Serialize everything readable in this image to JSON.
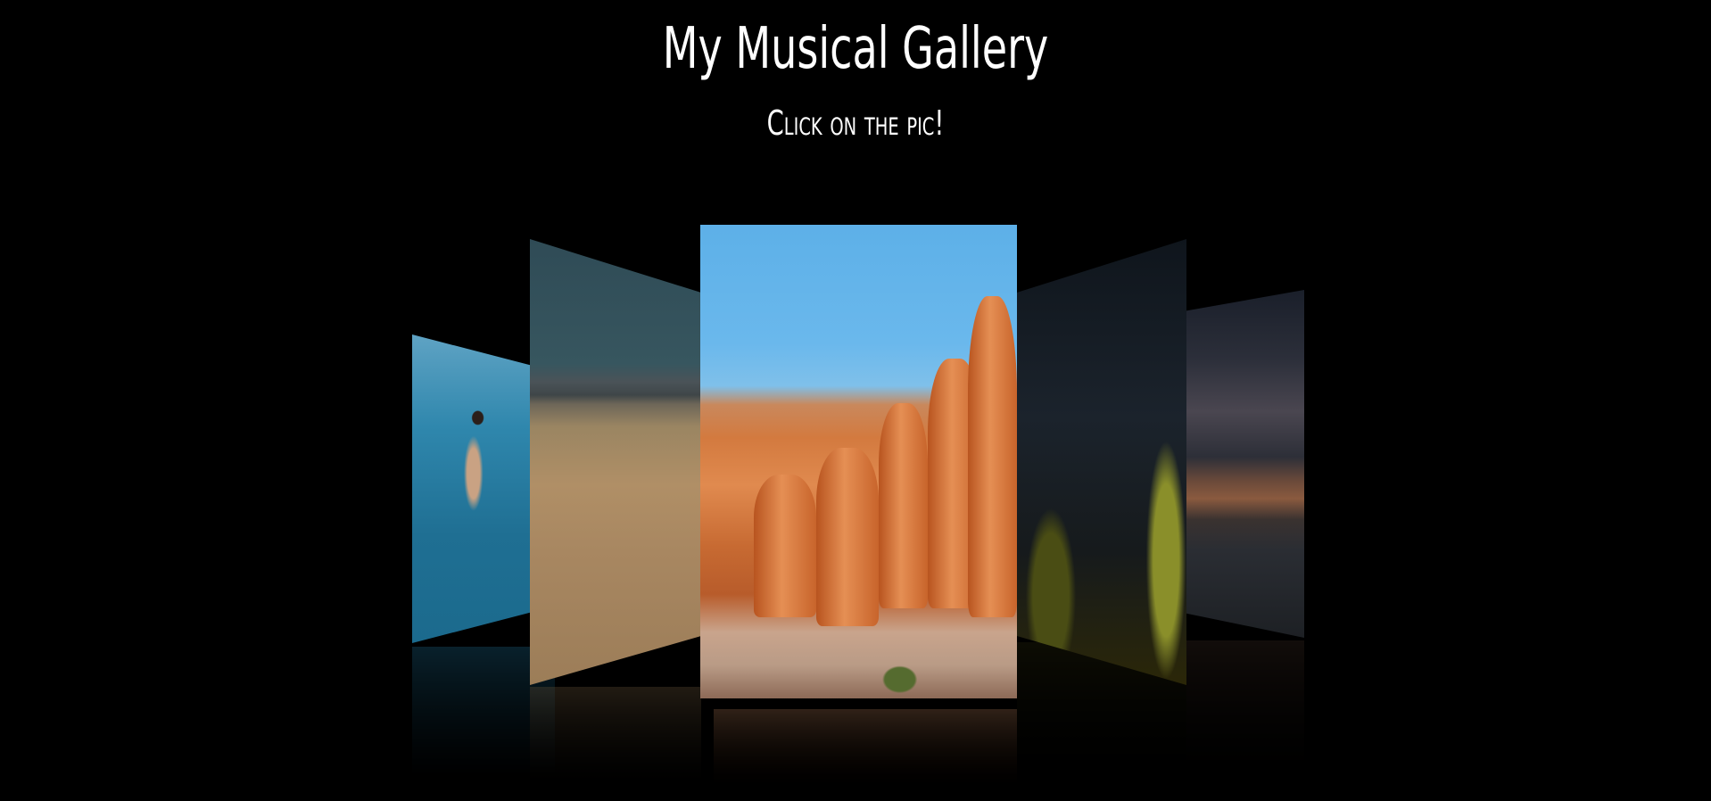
{
  "header": {
    "title": "My Musical Gallery",
    "subtitle": "Click on the pic!"
  },
  "gallery": {
    "cards": [
      {
        "name": "underwater-swimmer",
        "subject": "underwater swimmer"
      },
      {
        "name": "desert-dunes",
        "subject": "desert dunes"
      },
      {
        "name": "canyon-hoodoos",
        "subject": "canyon hoodoos"
      },
      {
        "name": "starry-forest",
        "subject": "starry sky over trees"
      },
      {
        "name": "milky-way-mountain",
        "subject": "milky way over mountain lake"
      }
    ]
  },
  "colors": {
    "background": "#000000",
    "text": "#ffffff"
  }
}
